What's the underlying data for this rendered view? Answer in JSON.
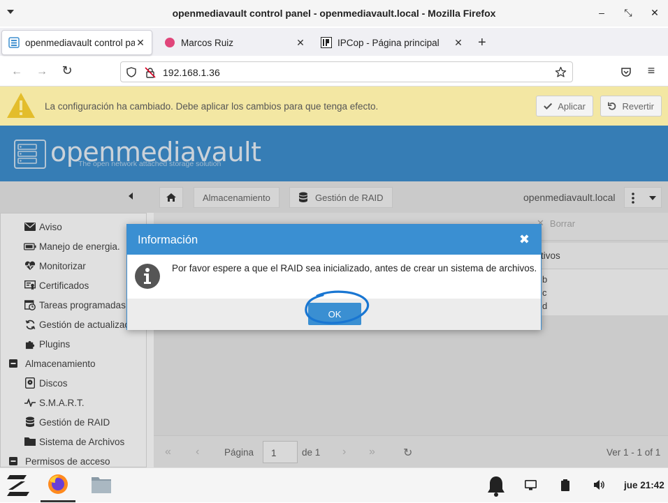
{
  "window": {
    "title": "openmediavault control panel - openmediavault.local - Mozilla Firefox",
    "minimize": "‒",
    "restore": "⤡",
    "close": "✕"
  },
  "tabs": [
    {
      "label": "openmediavault control pa",
      "active": true
    },
    {
      "label": "Marcos Ruiz",
      "active": false
    },
    {
      "label": "IPCop - Página principal",
      "active": false
    }
  ],
  "tab_close": "✕",
  "new_tab": "+",
  "nav": {
    "back": "←",
    "forward": "→",
    "reload": "↻",
    "url": "192.168.1.36",
    "menu": "≡"
  },
  "warning": {
    "message": "La configuración ha cambiado. Debe aplicar los cambios para que tenga efecto.",
    "apply_label": "Aplicar",
    "revert_label": "Revertir"
  },
  "brand": {
    "name": "openmediavault",
    "tagline": "The open network attached storage solution"
  },
  "breadcrumb": {
    "items": [
      "Almacenamiento",
      "Gestión de RAID"
    ],
    "host": "openmediavault.local"
  },
  "sidebar": {
    "items": [
      {
        "label": "Aviso",
        "icon": "envelope-icon"
      },
      {
        "label": "Manejo de energia.",
        "icon": "battery-icon"
      },
      {
        "label": "Monitorizar",
        "icon": "heartbeat-icon"
      },
      {
        "label": "Certificados",
        "icon": "certificate-icon"
      },
      {
        "label": "Tareas programadas",
        "icon": "calendar-clock-icon"
      },
      {
        "label": "Gestión de actualizac",
        "icon": "refresh-icon"
      },
      {
        "label": "Plugins",
        "icon": "puzzle-icon"
      },
      {
        "label": "Almacenamiento",
        "icon": "collapse-icon"
      },
      {
        "label": "Discos",
        "icon": "disk-icon"
      },
      {
        "label": "S.M.A.R.T.",
        "icon": "pulse-icon"
      },
      {
        "label": "Gestión de RAID",
        "icon": "database-icon"
      },
      {
        "label": "Sistema de Archivos",
        "icon": "folder-icon"
      },
      {
        "label": "Permisos de acceso",
        "icon": "collapse-icon"
      }
    ]
  },
  "grid": {
    "delete_label": "Borrar",
    "column_partial": "tivos",
    "cells": [
      "b",
      "c",
      "d"
    ]
  },
  "pagination": {
    "page_label": "Página",
    "page_value": "1",
    "of_label": "de 1",
    "summary": "Ver 1 - 1 of 1"
  },
  "dialog": {
    "title": "Información",
    "close": "✖",
    "message": "Por favor espere a que el RAID sea inicializado, antes de crear un sistema de archivos.",
    "ok_label": "OK"
  },
  "taskbar": {
    "clock": "jue 21:42"
  },
  "colors": {
    "omv_blue": "#3e8fcf",
    "warning_bg": "#f3e7a3",
    "dialog_header": "#3a8fd2"
  }
}
